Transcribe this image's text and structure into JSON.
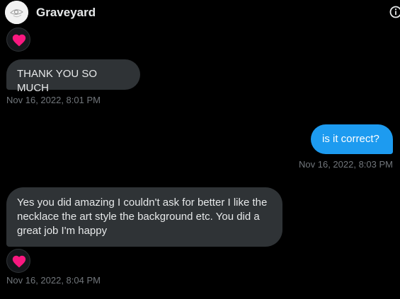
{
  "header": {
    "contact_name": "Graveyard",
    "avatar_icon": "avatar-icon",
    "info_icon": "info-icon"
  },
  "messages": [
    {
      "direction": "incoming",
      "text": "THANK YOU SO MUCH",
      "timestamp": "Nov 16, 2022, 8:01 PM",
      "reaction": "heart"
    },
    {
      "direction": "outgoing",
      "text": "is it correct?",
      "timestamp": "Nov 16, 2022, 8:03 PM"
    },
    {
      "direction": "incoming",
      "text": "Yes you did amazing I couldn't ask for better I like the necklace the art style the background etc. You did a great job I'm happy",
      "timestamp": "Nov 16, 2022, 8:04 PM",
      "reaction": "heart"
    }
  ],
  "colors": {
    "background": "#000000",
    "incoming_bubble": "#2f3336",
    "outgoing_bubble": "#1d9bf0",
    "timestamp": "#71767b",
    "heart": "#f91880"
  }
}
